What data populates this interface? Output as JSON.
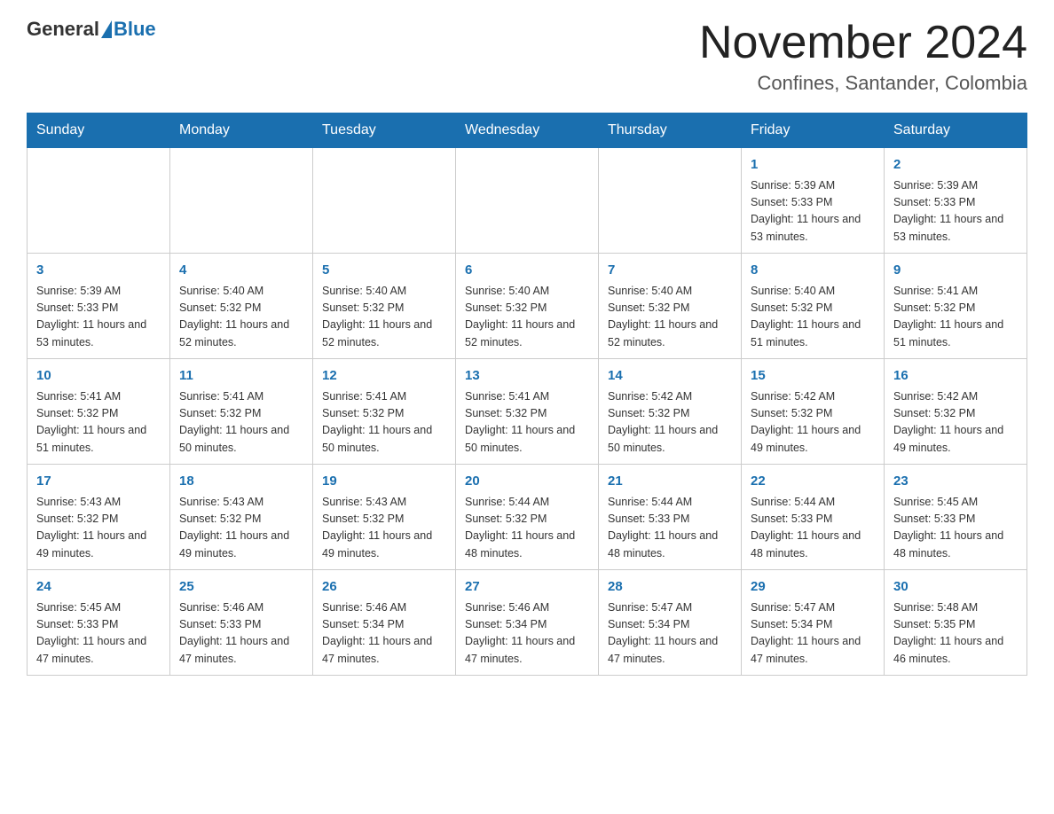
{
  "logo": {
    "general": "General",
    "blue": "Blue"
  },
  "title": "November 2024",
  "subtitle": "Confines, Santander, Colombia",
  "days_of_week": [
    "Sunday",
    "Monday",
    "Tuesday",
    "Wednesday",
    "Thursday",
    "Friday",
    "Saturday"
  ],
  "weeks": [
    [
      {
        "day": "",
        "info": ""
      },
      {
        "day": "",
        "info": ""
      },
      {
        "day": "",
        "info": ""
      },
      {
        "day": "",
        "info": ""
      },
      {
        "day": "",
        "info": ""
      },
      {
        "day": "1",
        "info": "Sunrise: 5:39 AM\nSunset: 5:33 PM\nDaylight: 11 hours and 53 minutes."
      },
      {
        "day": "2",
        "info": "Sunrise: 5:39 AM\nSunset: 5:33 PM\nDaylight: 11 hours and 53 minutes."
      }
    ],
    [
      {
        "day": "3",
        "info": "Sunrise: 5:39 AM\nSunset: 5:33 PM\nDaylight: 11 hours and 53 minutes."
      },
      {
        "day": "4",
        "info": "Sunrise: 5:40 AM\nSunset: 5:32 PM\nDaylight: 11 hours and 52 minutes."
      },
      {
        "day": "5",
        "info": "Sunrise: 5:40 AM\nSunset: 5:32 PM\nDaylight: 11 hours and 52 minutes."
      },
      {
        "day": "6",
        "info": "Sunrise: 5:40 AM\nSunset: 5:32 PM\nDaylight: 11 hours and 52 minutes."
      },
      {
        "day": "7",
        "info": "Sunrise: 5:40 AM\nSunset: 5:32 PM\nDaylight: 11 hours and 52 minutes."
      },
      {
        "day": "8",
        "info": "Sunrise: 5:40 AM\nSunset: 5:32 PM\nDaylight: 11 hours and 51 minutes."
      },
      {
        "day": "9",
        "info": "Sunrise: 5:41 AM\nSunset: 5:32 PM\nDaylight: 11 hours and 51 minutes."
      }
    ],
    [
      {
        "day": "10",
        "info": "Sunrise: 5:41 AM\nSunset: 5:32 PM\nDaylight: 11 hours and 51 minutes."
      },
      {
        "day": "11",
        "info": "Sunrise: 5:41 AM\nSunset: 5:32 PM\nDaylight: 11 hours and 50 minutes."
      },
      {
        "day": "12",
        "info": "Sunrise: 5:41 AM\nSunset: 5:32 PM\nDaylight: 11 hours and 50 minutes."
      },
      {
        "day": "13",
        "info": "Sunrise: 5:41 AM\nSunset: 5:32 PM\nDaylight: 11 hours and 50 minutes."
      },
      {
        "day": "14",
        "info": "Sunrise: 5:42 AM\nSunset: 5:32 PM\nDaylight: 11 hours and 50 minutes."
      },
      {
        "day": "15",
        "info": "Sunrise: 5:42 AM\nSunset: 5:32 PM\nDaylight: 11 hours and 49 minutes."
      },
      {
        "day": "16",
        "info": "Sunrise: 5:42 AM\nSunset: 5:32 PM\nDaylight: 11 hours and 49 minutes."
      }
    ],
    [
      {
        "day": "17",
        "info": "Sunrise: 5:43 AM\nSunset: 5:32 PM\nDaylight: 11 hours and 49 minutes."
      },
      {
        "day": "18",
        "info": "Sunrise: 5:43 AM\nSunset: 5:32 PM\nDaylight: 11 hours and 49 minutes."
      },
      {
        "day": "19",
        "info": "Sunrise: 5:43 AM\nSunset: 5:32 PM\nDaylight: 11 hours and 49 minutes."
      },
      {
        "day": "20",
        "info": "Sunrise: 5:44 AM\nSunset: 5:32 PM\nDaylight: 11 hours and 48 minutes."
      },
      {
        "day": "21",
        "info": "Sunrise: 5:44 AM\nSunset: 5:33 PM\nDaylight: 11 hours and 48 minutes."
      },
      {
        "day": "22",
        "info": "Sunrise: 5:44 AM\nSunset: 5:33 PM\nDaylight: 11 hours and 48 minutes."
      },
      {
        "day": "23",
        "info": "Sunrise: 5:45 AM\nSunset: 5:33 PM\nDaylight: 11 hours and 48 minutes."
      }
    ],
    [
      {
        "day": "24",
        "info": "Sunrise: 5:45 AM\nSunset: 5:33 PM\nDaylight: 11 hours and 47 minutes."
      },
      {
        "day": "25",
        "info": "Sunrise: 5:46 AM\nSunset: 5:33 PM\nDaylight: 11 hours and 47 minutes."
      },
      {
        "day": "26",
        "info": "Sunrise: 5:46 AM\nSunset: 5:34 PM\nDaylight: 11 hours and 47 minutes."
      },
      {
        "day": "27",
        "info": "Sunrise: 5:46 AM\nSunset: 5:34 PM\nDaylight: 11 hours and 47 minutes."
      },
      {
        "day": "28",
        "info": "Sunrise: 5:47 AM\nSunset: 5:34 PM\nDaylight: 11 hours and 47 minutes."
      },
      {
        "day": "29",
        "info": "Sunrise: 5:47 AM\nSunset: 5:34 PM\nDaylight: 11 hours and 47 minutes."
      },
      {
        "day": "30",
        "info": "Sunrise: 5:48 AM\nSunset: 5:35 PM\nDaylight: 11 hours and 46 minutes."
      }
    ]
  ]
}
